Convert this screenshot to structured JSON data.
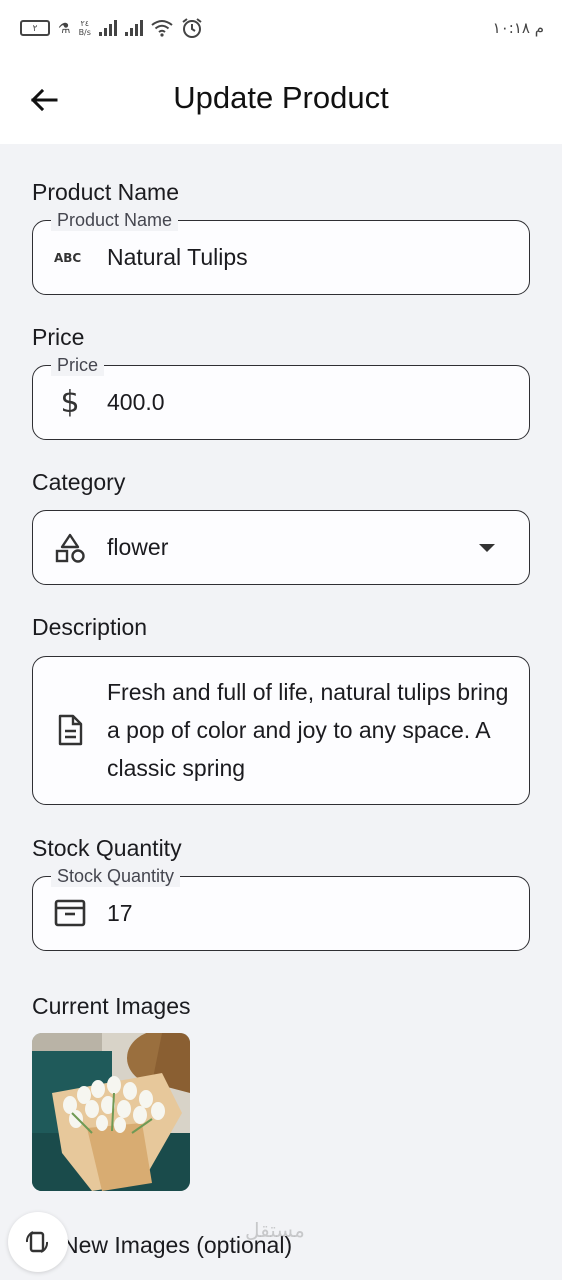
{
  "status_bar": {
    "sim_label": "٢",
    "net_speed_value": "٢٤",
    "net_speed_unit": "B/s",
    "time": "م ١٠:١٨"
  },
  "app_bar": {
    "title": "Update Product"
  },
  "form": {
    "product_name": {
      "section_label": "Product Name",
      "floating_label": "Product Name",
      "value": "Natural Tulips",
      "icon": "abc-icon"
    },
    "price": {
      "section_label": "Price",
      "floating_label": "Price",
      "value": "400.0",
      "icon": "dollar-icon"
    },
    "category": {
      "section_label": "Category",
      "value": "flower",
      "icon": "category-shapes-icon"
    },
    "description": {
      "section_label": "Description",
      "value": "Fresh and full of life, natural tulips bring a pop of color and joy to any space. A classic spring",
      "icon": "document-icon"
    },
    "stock_quantity": {
      "section_label": "Stock Quantity",
      "floating_label": "Stock Quantity",
      "value": "17",
      "icon": "archive-icon"
    }
  },
  "images": {
    "current_label": "Current Images",
    "new_label": "New Images (optional)"
  },
  "watermark": "مستقل",
  "colors": {
    "background": "#f2f3f6",
    "surface": "#ffffff",
    "border": "#2f2f33",
    "text": "#1b1b1f"
  }
}
